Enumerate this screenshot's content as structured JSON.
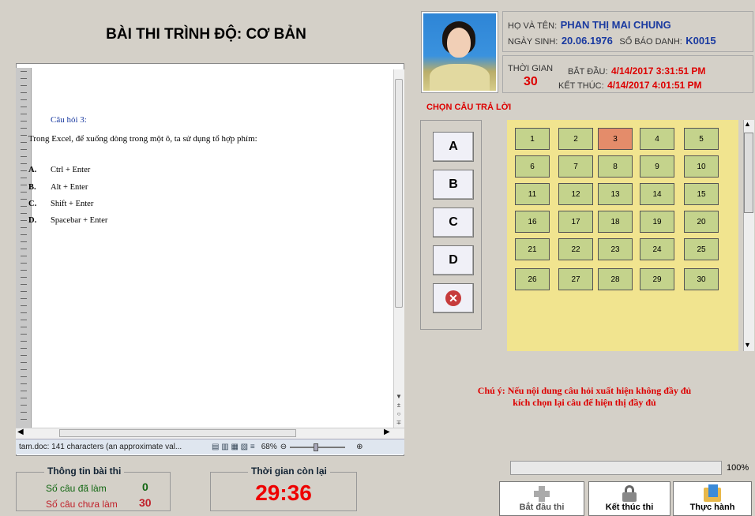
{
  "exam": {
    "title": "BÀI THI TRÌNH ĐỘ: CƠ BẢN"
  },
  "document": {
    "question_label": "Câu hỏi 3:",
    "question_text": "Trong Excel, để xuống dòng trong một ô, ta sử dụng tổ hợp phím:",
    "options": [
      {
        "letter": "A.",
        "text": "Ctrl + Enter"
      },
      {
        "letter": "B.",
        "text": "Alt + Enter"
      },
      {
        "letter": "C.",
        "text": "Shift + Enter"
      },
      {
        "letter": "D.",
        "text": "Spacebar + Enter"
      }
    ],
    "status_text": "tam.doc: 141 characters (an approximate val...",
    "zoom": "68%"
  },
  "candidate": {
    "name_label": "HỌ VÀ TÊN:",
    "name": "PHAN THỊ MAI CHUNG",
    "dob_label": "NGÀY SINH:",
    "dob": "20.06.1976",
    "id_label": "SỐ BÁO DANH:",
    "id": "K0015"
  },
  "time": {
    "label": "THỜI GIAN",
    "minutes": "30",
    "start_label": "BẮT ĐẦU:",
    "start": "4/14/2017 3:31:51 PM",
    "end_label": "KẾT THÚC:",
    "end": "4/14/2017 4:01:51 PM"
  },
  "answers": {
    "header": "CHỌN CÂU TRẢ LỜI",
    "buttons": [
      "A",
      "B",
      "C",
      "D"
    ]
  },
  "question_grid": {
    "numbers": [
      "1",
      "2",
      "3",
      "4",
      "5",
      "6",
      "7",
      "8",
      "9",
      "10",
      "11",
      "12",
      "13",
      "14",
      "15",
      "16",
      "17",
      "18",
      "19",
      "20",
      "21",
      "22",
      "23",
      "24",
      "25",
      "26",
      "27",
      "28",
      "29",
      "30"
    ],
    "selected": "3"
  },
  "note": {
    "line1": "Chú ý: Nếu nội dung câu hỏi  xuất hiện không đầy đủ",
    "line2": "kích chọn lại câu để hiện thị đầy đủ"
  },
  "progress": {
    "percent": "100%"
  },
  "info": {
    "legend": "Thông tin bài thi",
    "done_label": "Số câu đã làm",
    "done": "0",
    "todo_label": "Số câu chưa làm",
    "todo": "30"
  },
  "remaining": {
    "legend": "Thời gian còn lại",
    "value": "29:36"
  },
  "footer_buttons": {
    "start": "Bắt đầu thi",
    "finish": "Kết thúc thi",
    "practice": "Thực hành"
  },
  "colors": {
    "accent_red": "#dd0000",
    "name_blue": "#1a3aa0",
    "grid_bg": "#f1e48f",
    "cell": "#c4d38c",
    "cell_selected": "#e48c6a"
  }
}
